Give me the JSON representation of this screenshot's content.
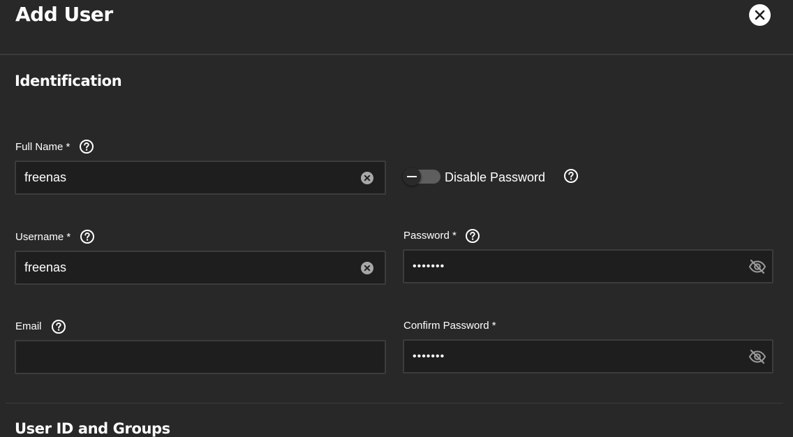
{
  "header": {
    "title": "Add User"
  },
  "sections": {
    "identification": "Identification",
    "user_id_groups": "User ID and Groups"
  },
  "fields": {
    "full_name": {
      "label": "Full Name *",
      "value": "freenas"
    },
    "username": {
      "label": "Username *",
      "value": "freenas"
    },
    "email": {
      "label": "Email",
      "value": ""
    },
    "password": {
      "label": "Password *",
      "value": "freenas"
    },
    "confirm_password": {
      "label": "Confirm Password *",
      "value": "freenas"
    }
  },
  "toggle": {
    "label": "Disable Password",
    "checked": false
  },
  "icons": {
    "close": "close-icon",
    "help": "help-circle-icon",
    "clear": "clear-circle-icon",
    "visibility": "eye-off-icon"
  },
  "colors": {
    "background": "#282828",
    "field_background": "#1e1e1e",
    "field_border": "#3c3c3c",
    "text": "#ffffff"
  }
}
